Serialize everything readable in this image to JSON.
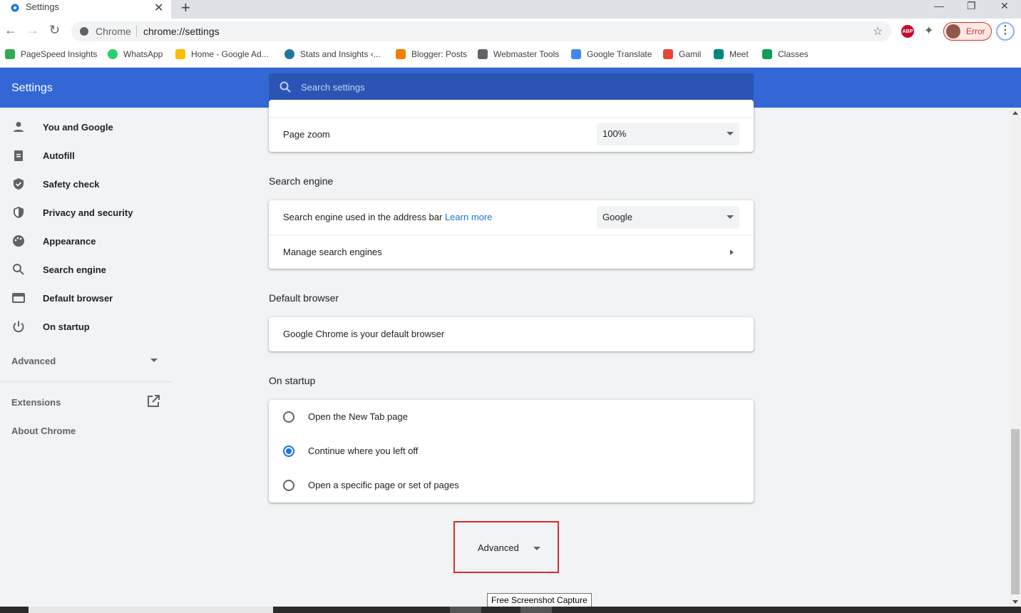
{
  "tab": {
    "title": "Settings",
    "close": "✕",
    "new_tab": "+"
  },
  "window": {
    "minimize": "—",
    "restore": "❐",
    "close": "✕"
  },
  "toolbar": {
    "back": "←",
    "forward": "→",
    "reload": "↻",
    "site_label": "Chrome",
    "url": "chrome://settings",
    "star": "☆",
    "extensions": "✦",
    "profile_status": "Error",
    "menu": "⋮",
    "abp_label": "ABP"
  },
  "bookmarks": [
    {
      "label": "PageSpeed Insights",
      "color": "#34a853"
    },
    {
      "label": "WhatsApp",
      "color": "#25d366"
    },
    {
      "label": "Home - Google Ad...",
      "color": "#fbbc04"
    },
    {
      "label": "Stats and Insights ‹...",
      "color": "#21759b"
    },
    {
      "label": "Blogger: Posts",
      "color": "#f57d00"
    },
    {
      "label": "Webmaster Tools",
      "color": "#5f6368"
    },
    {
      "label": "Google Translate",
      "color": "#4285f4"
    },
    {
      "label": "Gamil",
      "color": "#ea4335"
    },
    {
      "label": "Meet",
      "color": "#00897b"
    },
    {
      "label": "Classes",
      "color": "#0f9d58"
    }
  ],
  "header": {
    "title": "Settings",
    "search_placeholder": "Search settings"
  },
  "sidebar": {
    "items": [
      {
        "label": "You and Google",
        "icon": "person-icon"
      },
      {
        "label": "Autofill",
        "icon": "clipboard-icon"
      },
      {
        "label": "Safety check",
        "icon": "shield-check-icon"
      },
      {
        "label": "Privacy and security",
        "icon": "shield-icon"
      },
      {
        "label": "Appearance",
        "icon": "palette-icon"
      },
      {
        "label": "Search engine",
        "icon": "search-icon"
      },
      {
        "label": "Default browser",
        "icon": "browser-icon"
      },
      {
        "label": "On startup",
        "icon": "power-icon"
      }
    ],
    "advanced": "Advanced",
    "extensions": "Extensions",
    "about": "About Chrome"
  },
  "main": {
    "page_zoom": {
      "label": "Page zoom",
      "value": "100%"
    },
    "search_engine": {
      "title": "Search engine",
      "used_label": "Search engine used in the address bar",
      "learn_more": "Learn more",
      "value": "Google",
      "manage": "Manage search engines"
    },
    "default_browser": {
      "title": "Default browser",
      "text": "Google Chrome is your default browser"
    },
    "on_startup": {
      "title": "On startup",
      "options": [
        {
          "label": "Open the New Tab page",
          "selected": false
        },
        {
          "label": "Continue where you left off",
          "selected": true
        },
        {
          "label": "Open a specific page or set of pages",
          "selected": false
        }
      ]
    },
    "advanced_button": "Advanced"
  },
  "tooltip": "Free Screenshot Capture",
  "colors": {
    "header": "#3367d6",
    "accent": "#1a73e8",
    "highlight_box": "#d32f2f",
    "error": "#d93025"
  }
}
